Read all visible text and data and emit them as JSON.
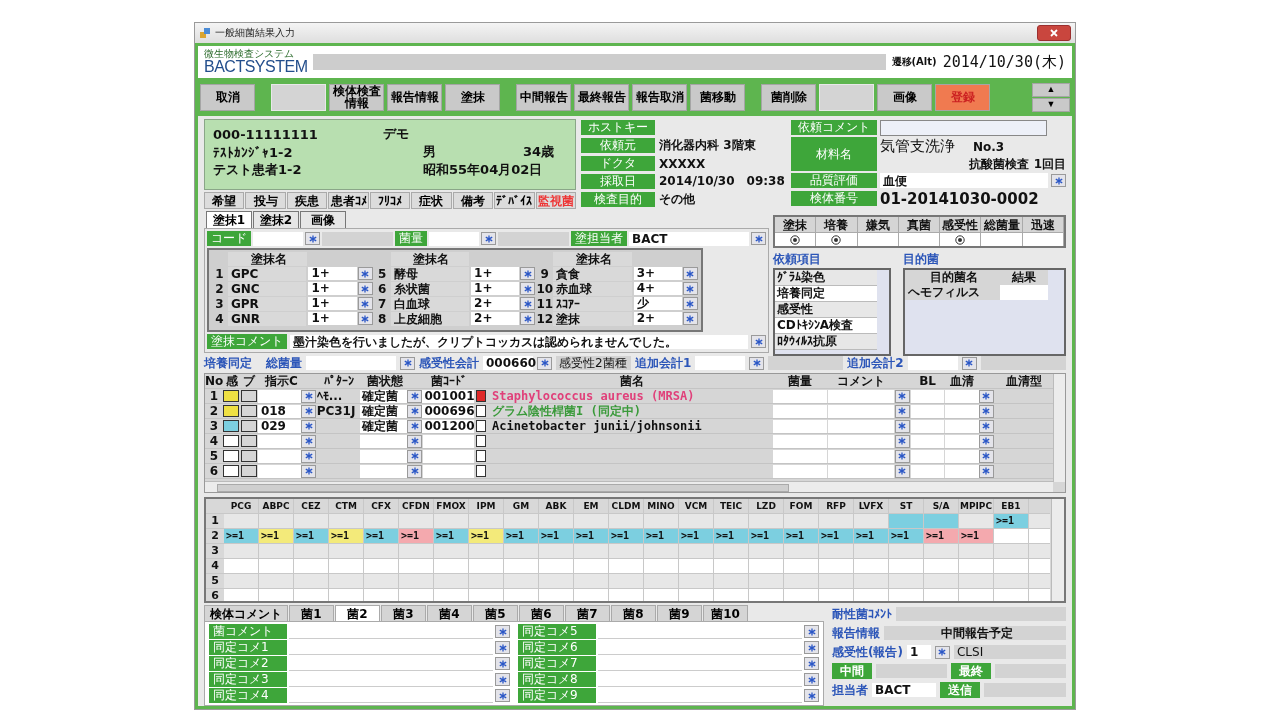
{
  "window": {
    "title": "一般細菌結果入力"
  },
  "header": {
    "system_name": "微生物検査システム",
    "logo": "BACTSYSTEM",
    "mode": "遷移(Alt)",
    "date": "2014/10/30(木)"
  },
  "toolbar": [
    [
      {
        "kind": "button",
        "label": "取消"
      }
    ],
    [
      {
        "kind": "blank"
      },
      {
        "kind": "button",
        "label": "検体検査情報"
      },
      {
        "kind": "button",
        "label": "報告情報"
      },
      {
        "kind": "button",
        "label": "塗抹"
      }
    ],
    [
      {
        "kind": "button",
        "label": "中間報告"
      },
      {
        "kind": "button",
        "label": "最終報告"
      },
      {
        "kind": "button",
        "label": "報告取消"
      },
      {
        "kind": "button",
        "label": "菌移動"
      }
    ],
    [
      {
        "kind": "button",
        "label": "菌削除"
      },
      {
        "kind": "blank"
      },
      {
        "kind": "button",
        "label": "画像"
      },
      {
        "kind": "primary",
        "label": "登録"
      }
    ]
  ],
  "scroll_arrows": [
    "▲",
    "▼"
  ],
  "patient": {
    "id": "000-11111111",
    "tag": "デモ",
    "kana": "ﾃｽﾄｶﾝｼﾞｬ1-2",
    "name": "テスト患者1-2",
    "sex": "男",
    "age": "34歳",
    "birth": "昭和55年04月02日"
  },
  "patient_tabs": [
    {
      "label": "希望",
      "alert": false
    },
    {
      "label": "投与",
      "alert": false
    },
    {
      "label": "疾患",
      "alert": false
    },
    {
      "label": "患者ｺﾒ",
      "alert": false
    },
    {
      "label": "ﾌﾘｺﾒ",
      "alert": false
    },
    {
      "label": "症状",
      "alert": false
    },
    {
      "label": "備考",
      "alert": false
    },
    {
      "label": "ﾃﾞﾊﾞｲｽ",
      "alert": false
    },
    {
      "label": "監視菌",
      "alert": true
    }
  ],
  "order_fields": [
    {
      "label": "ホストキー"
    },
    {
      "label": "依頼元",
      "value": "消化器内科 3階東"
    },
    {
      "label": "ドクタ",
      "value": "XXXXX"
    },
    {
      "label": "採取日",
      "value": "2014/10/30　09:38"
    },
    {
      "label": "検査目的",
      "value": "その他"
    }
  ],
  "request_comment": {
    "label": "依頼コメント"
  },
  "material": {
    "label": "材料名",
    "name": "気管支洗浄",
    "number": "No.3",
    "note": "抗酸菌検査 1回目"
  },
  "quality": {
    "label": "品質評価",
    "value": "血便"
  },
  "specimen_no": {
    "label": "検体番号",
    "value": "01-20141030-0002"
  },
  "test_status": [
    {
      "label": "塗抹",
      "on": true
    },
    {
      "label": "培養",
      "on": true
    },
    {
      "label": "嫌気",
      "on": false
    },
    {
      "label": "真菌",
      "on": false
    },
    {
      "label": "感受性",
      "on": true
    },
    {
      "label": "総菌量",
      "on": false
    },
    {
      "label": "迅速",
      "on": false
    }
  ],
  "requested_items": {
    "title": "依頼項目",
    "items": [
      "ｸﾞﾗﾑ染色",
      "培養同定",
      "感受性",
      "CDﾄｷｼﾝA検査",
      "ﾛﾀｳｨﾙｽ抗原"
    ]
  },
  "target": {
    "title": "目的菌",
    "columns": [
      "目的菌名",
      "結果"
    ],
    "rows": [
      {
        "name": "ヘモフィルス"
      }
    ]
  },
  "smear_tabs": [
    {
      "label": "塗抹1",
      "selected": true
    },
    {
      "label": "塗抹2",
      "selected": false
    },
    {
      "label": "画像",
      "selected": false
    }
  ],
  "smear_fields": {
    "code": "コード",
    "amount": "菌量",
    "staff_label": "塗担当者",
    "staff": "BACT"
  },
  "smear_headers": [
    "塗抹名",
    "塗抹名",
    "塗抹名"
  ],
  "smear_rows": [
    {
      "no": "1",
      "name": "GPC",
      "value": "1+"
    },
    {
      "no": "2",
      "name": "GNC",
      "value": "1+"
    },
    {
      "no": "3",
      "name": "GPR",
      "value": "1+"
    },
    {
      "no": "4",
      "name": "GNR",
      "value": "1+"
    },
    {
      "no": "5",
      "name": "酵母",
      "value": "1+"
    },
    {
      "no": "6",
      "name": "糸状菌",
      "value": "1+"
    },
    {
      "no": "7",
      "name": "白血球",
      "value": "2+"
    },
    {
      "no": "8",
      "name": "上皮細胞",
      "value": "2+"
    },
    {
      "no": "9",
      "name": "貪食",
      "value": "3+"
    },
    {
      "no": "10",
      "name": "赤血球",
      "value": "4+"
    },
    {
      "no": "11",
      "name": "ｽｺｱｰ",
      "value": "少"
    },
    {
      "no": "12",
      "name": "塗抹",
      "value": "2+"
    }
  ],
  "smear_comment": {
    "label": "塗抹コメント",
    "text": "墨汁染色を行いましたが、クリプトコッカスは認められませんでした。"
  },
  "culture": {
    "title": "培養同定",
    "total_label": "総菌量",
    "sus_label": "感受性会計",
    "sus_value": "000660",
    "sus_note": "感受性2菌種",
    "add1": "追加会計1",
    "add2": "追加会計2"
  },
  "isolate_columns": [
    "No",
    "感",
    "ブ",
    "指示C",
    "ﾊﾟﾀｰﾝ",
    "菌状態",
    "菌ｺｰﾄﾞ",
    "菌名",
    "菌量",
    "コメント",
    "BL",
    "血清",
    "血清型"
  ],
  "isolates": [
    {
      "no": "1",
      "color": "#efe043",
      "pattern": "ﾍﾓ...",
      "state": "確定菌",
      "code": "001001",
      "flagged": true,
      "checked": false,
      "kind": "alert",
      "name": "Staphylococcus aureus (MRSA)"
    },
    {
      "no": "2",
      "color": "#efe043",
      "order": "018",
      "pattern": "PC31J",
      "state": "確定菌",
      "code": "000696",
      "flagged": false,
      "checked": false,
      "kind": "pending",
      "name": "グラム陰性桿菌I (同定中)"
    },
    {
      "no": "3",
      "color": "#7ccfe0",
      "order": "029",
      "state": "確定菌",
      "code": "001200",
      "flagged": false,
      "checked": false,
      "kind": "confirmed",
      "name": "Acinetobacter junii/johnsonii"
    },
    {
      "no": "4",
      "flagged": false,
      "checked": false
    },
    {
      "no": "5",
      "flagged": false,
      "checked": false
    },
    {
      "no": "6",
      "flagged": false,
      "checked": false
    }
  ],
  "sus_columns": [
    "PCG",
    "ABPC",
    "CEZ",
    "CTM",
    "CFX",
    "CFDN",
    "FMOX",
    "IPM",
    "GM",
    "ABK",
    "EM",
    "CLDM",
    "MINO",
    "VCM",
    "TEIC",
    "LZD",
    "FOM",
    "RFP",
    "LVFX",
    "ST",
    "S/A",
    "MPIPC",
    "EB1"
  ],
  "sus_rows": [
    {
      "no": "1",
      "cells": [
        {},
        {},
        {},
        {},
        {},
        {},
        {},
        {},
        {},
        {},
        {},
        {},
        {},
        {},
        {},
        {},
        {},
        {},
        {},
        {
          "color": "#7ccfe0"
        },
        {
          "color": "#7ccfe0"
        },
        {},
        {
          "text": ">=1",
          "color": "#7ccfe0"
        }
      ]
    },
    {
      "no": "2",
      "cells": [
        {
          "text": ">=1",
          "color": "#7ccfe0"
        },
        {
          "text": ">=1",
          "color": "#f3ea7a"
        },
        {
          "text": ">=1",
          "color": "#7ccfe0"
        },
        {
          "text": ">=1",
          "color": "#f3ea7a"
        },
        {
          "text": ">=1",
          "color": "#7ccfe0"
        },
        {
          "text": ">=1",
          "color": "#f4a9ae"
        },
        {
          "text": ">=1",
          "color": "#7ccfe0"
        },
        {
          "text": ">=1",
          "color": "#f3ea7a"
        },
        {
          "text": ">=1",
          "color": "#7ccfe0"
        },
        {
          "text": ">=1",
          "color": "#7ccfe0"
        },
        {
          "text": ">=1",
          "color": "#7ccfe0"
        },
        {
          "text": ">=1",
          "color": "#7ccfe0"
        },
        {
          "text": ">=1",
          "color": "#7ccfe0"
        },
        {
          "text": ">=1",
          "color": "#7ccfe0"
        },
        {
          "text": ">=1",
          "color": "#7ccfe0"
        },
        {
          "text": ">=1",
          "color": "#7ccfe0"
        },
        {
          "text": ">=1",
          "color": "#7ccfe0"
        },
        {
          "text": ">=1",
          "color": "#7ccfe0"
        },
        {
          "text": ">=1",
          "color": "#7ccfe0"
        },
        {
          "text": ">=1",
          "color": "#7ccfe0"
        },
        {
          "text": ">=1",
          "color": "#f4a9ae"
        },
        {
          "text": ">=1",
          "color": "#f4a9ae"
        },
        {}
      ]
    },
    {
      "no": "3"
    },
    {
      "no": "4"
    },
    {
      "no": "5"
    },
    {
      "no": "6"
    }
  ],
  "bottom_tabs": [
    {
      "label": "検体コメント",
      "selected": false
    },
    {
      "label": "菌1",
      "selected": false
    },
    {
      "label": "菌2",
      "selected": true
    },
    {
      "label": "菌3",
      "selected": false
    },
    {
      "label": "菌4",
      "selected": false
    },
    {
      "label": "菌5",
      "selected": false
    },
    {
      "label": "菌6",
      "selected": false
    },
    {
      "label": "菌7",
      "selected": false
    },
    {
      "label": "菌8",
      "selected": false
    },
    {
      "label": "菌9",
      "selected": false
    },
    {
      "label": "菌10",
      "selected": false
    }
  ],
  "comments_left": [
    "菌コメント",
    "同定コメ1",
    "同定コメ2",
    "同定コメ3",
    "同定コメ4"
  ],
  "comments_right": [
    "同定コメ5",
    "同定コメ6",
    "同定コメ7",
    "同定コメ8",
    "同定コメ9"
  ],
  "report_panel": {
    "resistant_label": "耐性菌ｺﾒﾝﾄ",
    "report_label": "報告情報",
    "report_value": "中間報告予定",
    "sus_label": "感受性(報告)",
    "sus_value": "1",
    "standard": "CLSI",
    "interim": "中間",
    "final": "最終",
    "staff_label": "担当者",
    "staff": "BACT",
    "send": "送信"
  }
}
